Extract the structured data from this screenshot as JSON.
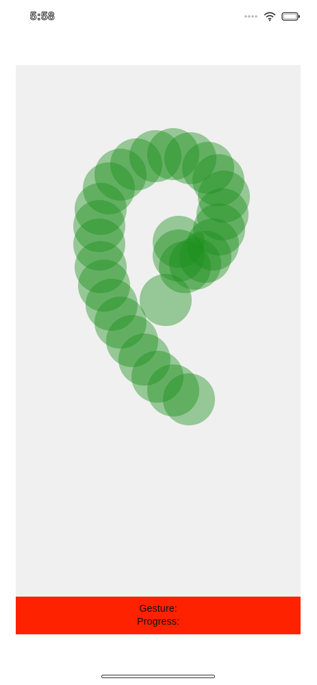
{
  "status_bar": {
    "time": "5:58",
    "icons": [
      "signal-dots-icon",
      "wifi-icon",
      "battery-icon"
    ]
  },
  "canvas": {
    "background_color": "#f0f0f0",
    "circle_color": "#1a8f1a",
    "circle_opacity": 0.42,
    "trail_shape": "spiral"
  },
  "info_panel": {
    "background_color": "#ff2200",
    "gesture_label": "Gesture:",
    "progress_label": "Progress:"
  }
}
